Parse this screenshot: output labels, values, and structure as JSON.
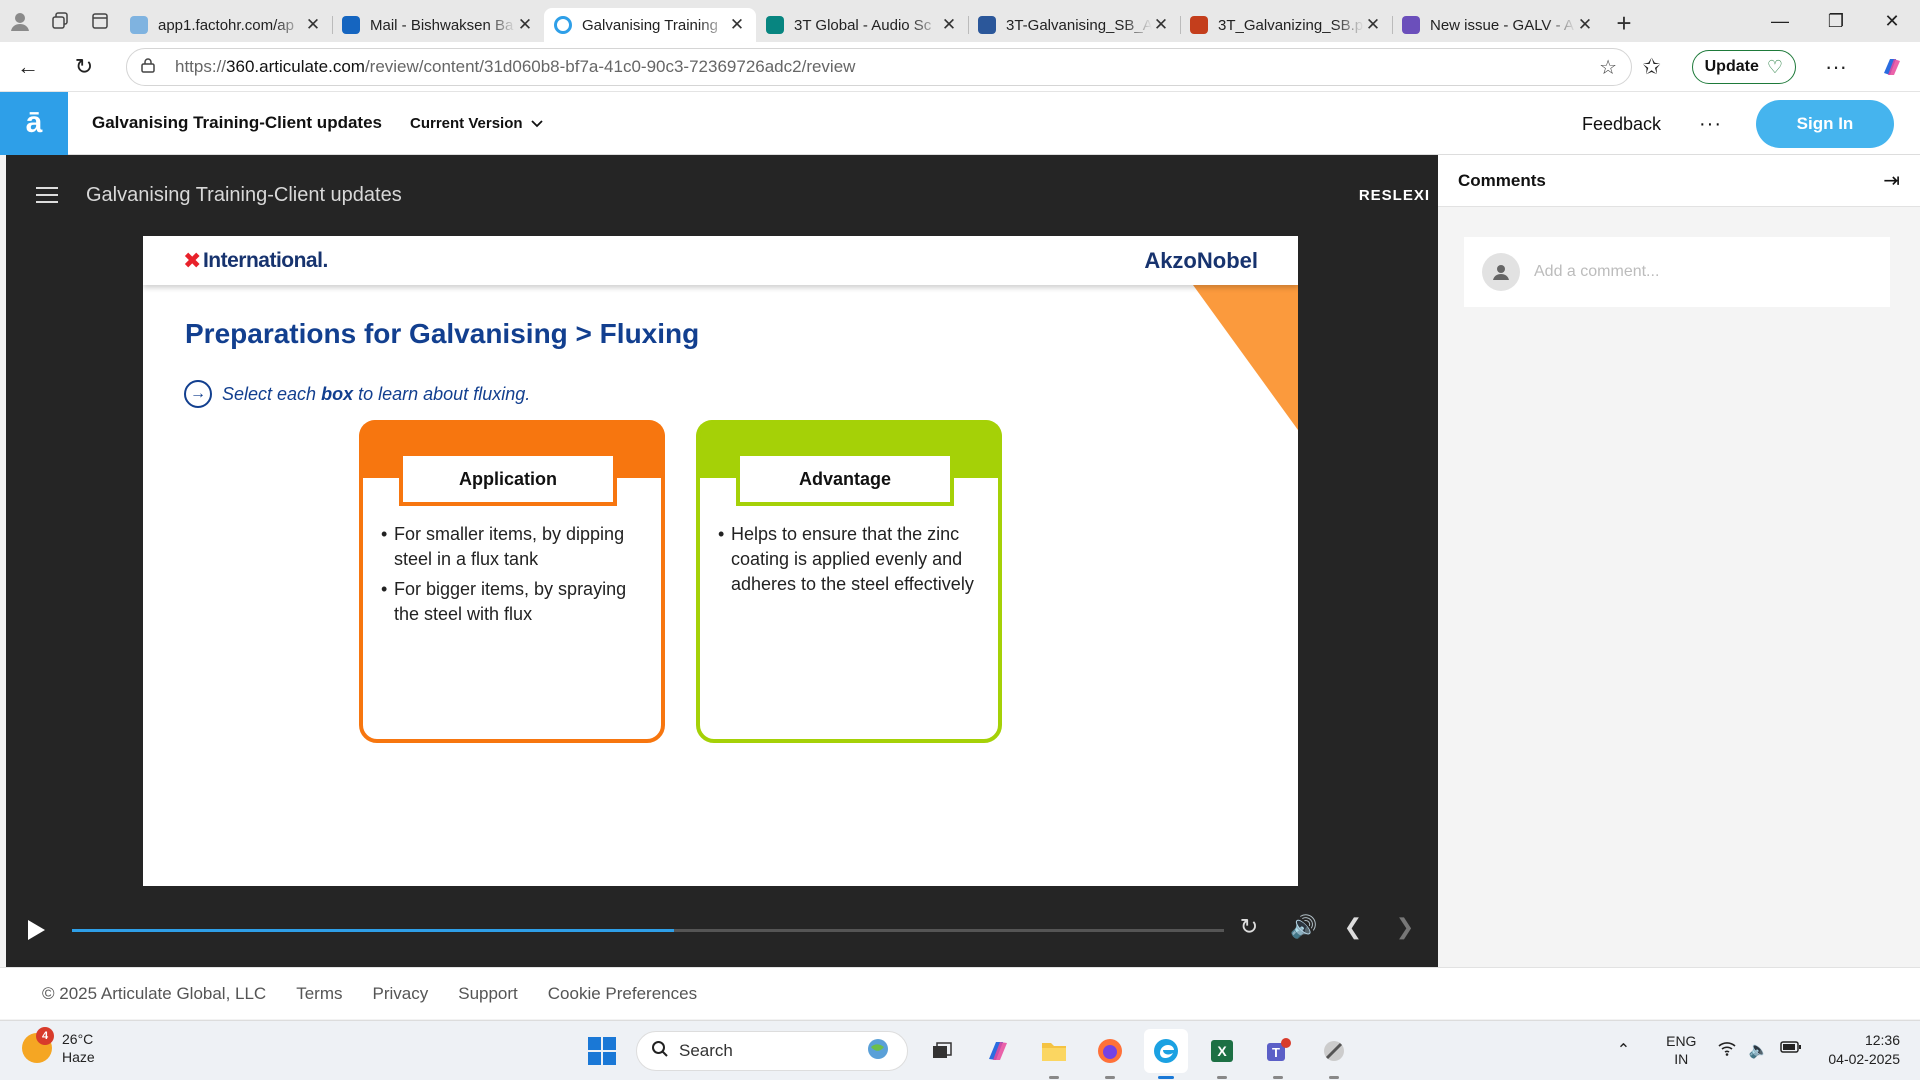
{
  "browser": {
    "tabs": [
      {
        "label": "app1.factohr.com/ap",
        "favicon_color": "#7fb3e0",
        "active": false
      },
      {
        "label": "Mail - Bishwaksen Ba",
        "favicon_color": "#1565c0",
        "active": false
      },
      {
        "label": "Galvanising Training",
        "favicon_color": "#2e9fe8",
        "active": true
      },
      {
        "label": "3T Global - Audio Sc",
        "favicon_color": "#078580",
        "active": false
      },
      {
        "label": "3T-Galvanising_SB_A",
        "favicon_color": "#2b579a",
        "active": false
      },
      {
        "label": "3T_Galvanizing_SB.p",
        "favicon_color": "#c43e1c",
        "active": false
      },
      {
        "label": "New issue - GALV - A",
        "favicon_color": "#6b4fbb",
        "active": false
      }
    ],
    "url": {
      "protocol": "https://",
      "host": "360.articulate.com",
      "path": "/review/content/31d060b8-bf7a-41c0-90c3-72369726adc2/review"
    },
    "update_label": "Update"
  },
  "app_header": {
    "logo": "ā",
    "title": "Galvanising Training-Client updates",
    "version_label": "Current Version",
    "feedback_label": "Feedback",
    "more_label": "···",
    "signin_label": "Sign In"
  },
  "player": {
    "title": "Galvanising Training-Client updates",
    "brand": "RESLEXI",
    "progress": 0.523,
    "slide": {
      "logo_left": "International.",
      "logo_right": "AkzoNobel",
      "heading": "Preparations for Galvanising > Fluxing",
      "instruction": {
        "pre": "Select each ",
        "bold": "box",
        "post": " to learn about fluxing."
      },
      "cards": [
        {
          "label": "Application",
          "color": "#f7760f",
          "bullets": [
            "For smaller items, by dipping steel in a flux tank",
            "For bigger items, by spraying the steel with flux"
          ]
        },
        {
          "label": "Advantage",
          "color": "#a5d107",
          "bullets": [
            "Helps to ensure that the zinc coating is applied evenly and adheres to the steel effectively"
          ]
        }
      ]
    }
  },
  "comments": {
    "title": "Comments",
    "placeholder": "Add a comment..."
  },
  "footer": {
    "copyright": "© 2025 Articulate Global, LLC",
    "links": [
      "Terms",
      "Privacy",
      "Support",
      "Cookie Preferences"
    ]
  },
  "taskbar": {
    "weather": {
      "temp": "26°C",
      "condition": "Haze",
      "badge": "4"
    },
    "search_label": "Search",
    "lang": {
      "line1": "ENG",
      "line2": "IN"
    },
    "time": "12:36",
    "date": "04-02-2025"
  }
}
